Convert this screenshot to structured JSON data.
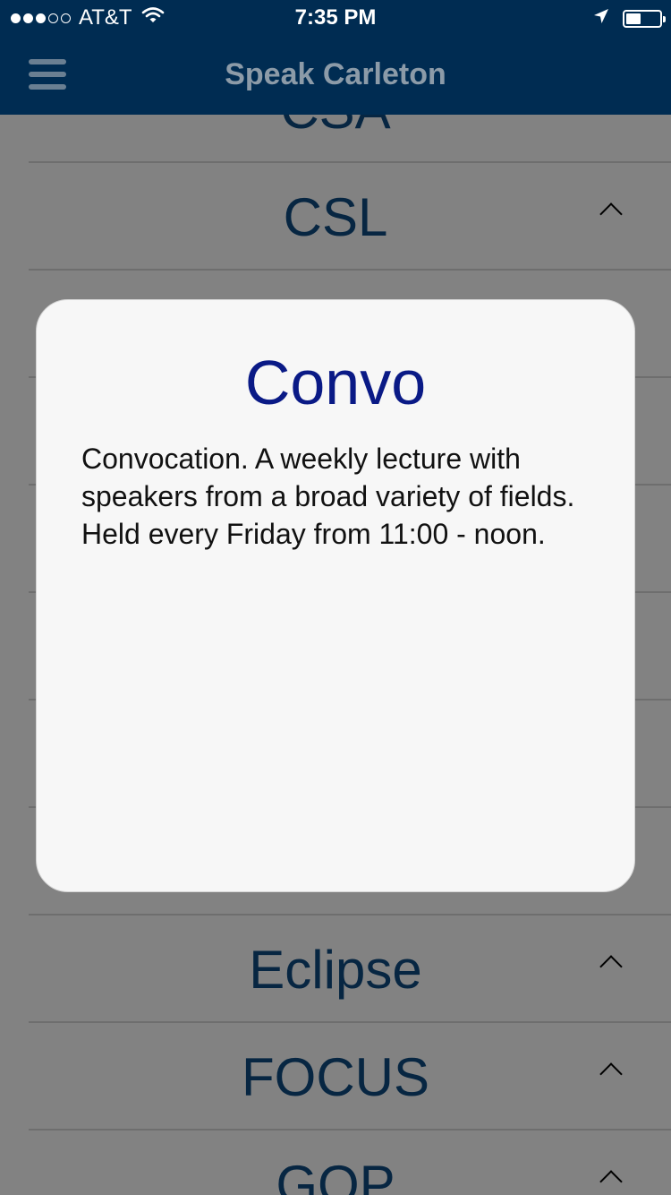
{
  "status_bar": {
    "signal_strength": "3 of 5 bars",
    "carrier": "AT&T",
    "time": "7:35 PM",
    "wifi_icon": "wifi-icon",
    "location_icon": "location-arrow-icon",
    "battery_icon": "battery-icon",
    "battery_level": 0.4
  },
  "nav": {
    "menu_icon": "hamburger-menu-icon",
    "title": "Speak Carleton"
  },
  "list": {
    "items": [
      {
        "label": "CSA",
        "chevron": "chevron-up-icon"
      },
      {
        "label": "CSL",
        "chevron": "chevron-up-icon"
      },
      {
        "label": "",
        "chevron": "chevron-up-icon"
      },
      {
        "label": "",
        "chevron": "chevron-up-icon"
      },
      {
        "label": "",
        "chevron": "chevron-up-icon"
      },
      {
        "label": "",
        "chevron": "chevron-up-icon"
      },
      {
        "label": "",
        "chevron": "chevron-up-icon"
      },
      {
        "label": "Eclipse",
        "chevron": "chevron-up-icon"
      },
      {
        "label": "FOCUS",
        "chevron": "chevron-up-icon"
      },
      {
        "label": "GOP",
        "chevron": "chevron-up-icon"
      }
    ]
  },
  "modal": {
    "title": "Convo",
    "body": "Convocation. A weekly lecture with speakers from a broad variety of fields.  Held every Friday from 11:00 - noon."
  },
  "colors": {
    "nav_background": "#002c52",
    "list_label": "#0f4c81",
    "modal_title": "#0a1a86"
  }
}
